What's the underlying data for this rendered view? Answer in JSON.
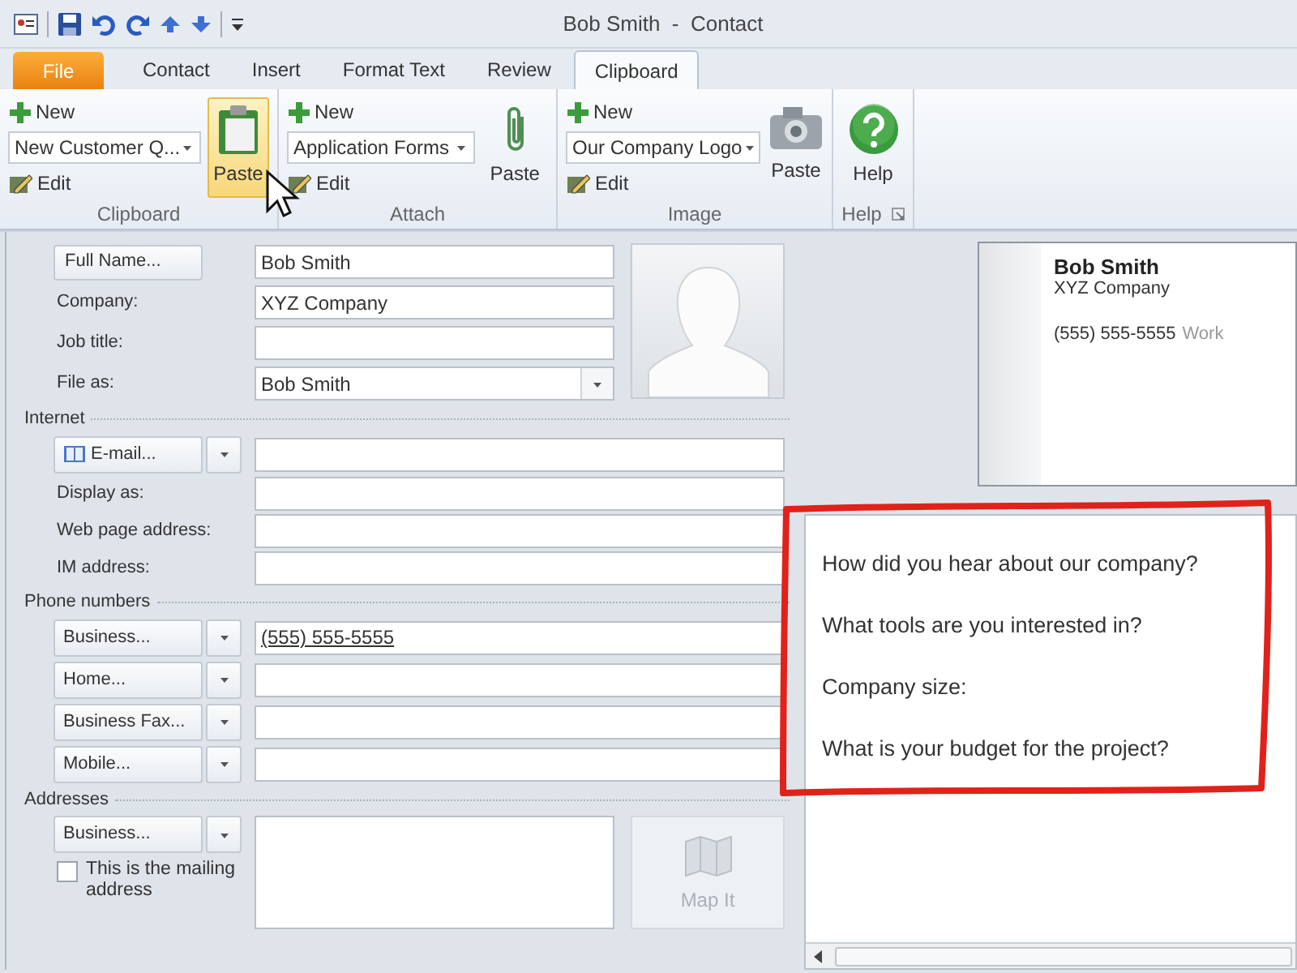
{
  "window": {
    "title": "Bob Smith  -  Contact"
  },
  "tabs": [
    {
      "label": "File",
      "kind": "file",
      "selected": false
    },
    {
      "label": "Contact",
      "kind": "tab",
      "selected": false
    },
    {
      "label": "Insert",
      "kind": "tab",
      "selected": false
    },
    {
      "label": "Format Text",
      "kind": "tab",
      "selected": false
    },
    {
      "label": "Review",
      "kind": "tab",
      "selected": false
    },
    {
      "label": "Clipboard",
      "kind": "tab",
      "selected": true
    }
  ],
  "ribbon": {
    "groups": [
      {
        "kind": "gallery",
        "label": "Clipboard",
        "new": "New",
        "dropdown": "New Customer Q...",
        "edit": "Edit",
        "action": {
          "label": "Paste",
          "highlighted": true
        }
      },
      {
        "kind": "gallery",
        "label": "Attach",
        "new": "New",
        "dropdown": "Application Forms",
        "edit": "Edit",
        "action": {
          "label": "Paste",
          "highlighted": false
        }
      },
      {
        "kind": "gallery",
        "label": "Image",
        "new": "New",
        "dropdown": "Our Company Logo",
        "edit": "Edit",
        "action": {
          "label": "Paste",
          "highlighted": false
        }
      },
      {
        "kind": "help",
        "label": "Help",
        "action": {
          "label": "Help",
          "highlighted": false
        }
      }
    ]
  },
  "form": {
    "top_rows": [
      {
        "kind": "button",
        "label": "Full Name...",
        "value": "Bob Smith"
      },
      {
        "kind": "label",
        "label": "Company:",
        "value": "XYZ Company"
      },
      {
        "kind": "label",
        "label": "Job title:"
      },
      {
        "kind": "combo",
        "label": "File as:",
        "value": "Bob Smith"
      }
    ],
    "sections": [
      {
        "title": "Internet",
        "rows": [
          {
            "kind": "split",
            "label": "E-mail...",
            "icon": true
          },
          {
            "kind": "label",
            "label": "Display as:"
          },
          {
            "kind": "label",
            "label": "Web page address:"
          },
          {
            "kind": "label",
            "label": "IM address:"
          }
        ]
      },
      {
        "title": "Phone numbers",
        "rows": [
          {
            "kind": "split",
            "label": "Business...",
            "value": "(555) 555-5555"
          },
          {
            "kind": "split",
            "label": "Home..."
          },
          {
            "kind": "split",
            "label": "Business Fax..."
          },
          {
            "kind": "split",
            "label": "Mobile..."
          }
        ]
      },
      {
        "title": "Addresses"
      }
    ],
    "address": {
      "type": "Business...",
      "mailing": {
        "label": "This is the mailing address",
        "checked": false
      },
      "map_button": {
        "label": "Map It",
        "disabled": true
      }
    }
  },
  "business_card": {
    "name": "Bob Smith",
    "company": "XYZ Company",
    "phone": "(555) 555-5555",
    "phone_type": "Work"
  },
  "notes": {
    "lines": [
      "How did you hear about our company?",
      "What tools are you interested in?",
      "Company size:",
      "What is your budget for the project?"
    ]
  }
}
